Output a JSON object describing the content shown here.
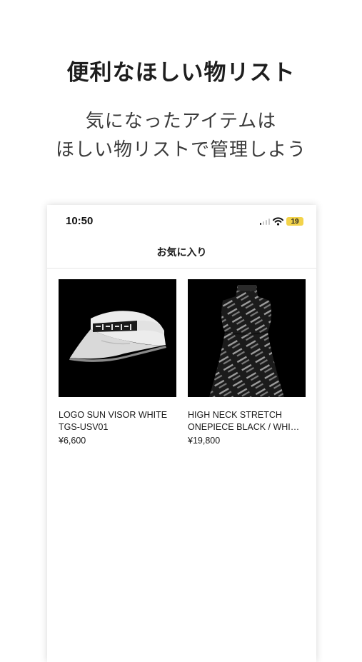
{
  "promo": {
    "headline": "便利なほしい物リスト",
    "subline_1": "気になったアイテムは",
    "subline_2": "ほしい物リストで管理しよう"
  },
  "status_bar": {
    "time": "10:50",
    "battery": "19",
    "icons": [
      "cellular-signal-icon",
      "wifi-icon",
      "battery-icon"
    ]
  },
  "nav": {
    "title": "お気に入り"
  },
  "favorites": [
    {
      "image": "white-sun-visor-photo",
      "name": "LOGO SUN VISOR WHITE\nTGS-USV01",
      "price": "¥6,600"
    },
    {
      "image": "black-logo-print-dress-photo",
      "name": "HIGH NECK STRETCH\nONEPIECE BLACK / WHI…",
      "price": "¥19,800"
    }
  ],
  "colors": {
    "battery": "#f3d34a",
    "image_background": "#000000"
  }
}
